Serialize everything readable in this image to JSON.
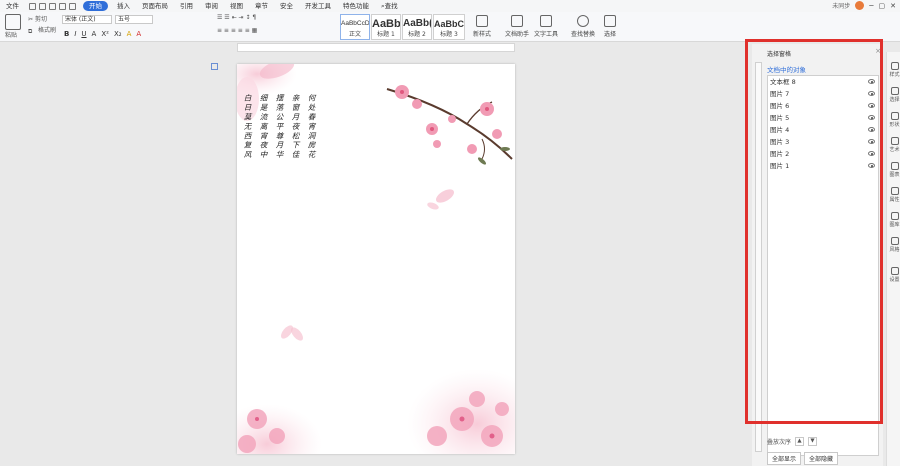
{
  "menu": {
    "file": "文件",
    "items": [
      "开始",
      "插入",
      "页面布局",
      "引用",
      "审阅",
      "视图",
      "章节",
      "安全",
      "开发工具",
      "特色功能"
    ],
    "active": "开始",
    "search": "查找",
    "sync": "未同步"
  },
  "ribbon": {
    "cut": "剪切",
    "paste": "粘贴",
    "format_painter": "格式刷",
    "font_name": "宋体 (正文)",
    "font_size": "五号",
    "format_buttons": [
      "B",
      "I",
      "U",
      "A",
      "X²",
      "X₂",
      "A",
      "A"
    ],
    "styles": [
      {
        "sample": "AaBbCcDd",
        "label": "正文"
      },
      {
        "sample": "AaBb",
        "label": "标题 1"
      },
      {
        "sample": "AaBb(",
        "label": "标题 2"
      },
      {
        "sample": "AaBbC",
        "label": "标题 3"
      }
    ],
    "new_style": "新样式",
    "doc_assistant": "文档助手",
    "text_tools": "文字工具",
    "find_replace": "查找替换",
    "select": "选择"
  },
  "document": {
    "poem_columns": [
      "何处春宵洞房花",
      "亲窗月夜松下佳",
      "摆落公平尊月华",
      "细是流离宵夜中",
      "白日莫无西复风",
      "漫游宫高作开",
      "前花春花月",
      "情明宫西"
    ]
  },
  "selection_pane": {
    "title": "选择窗格",
    "subtitle": "文档中的对象",
    "objects": [
      "文本框 8",
      "图片 7",
      "图片 6",
      "图片 5",
      "图片 4",
      "图片 3",
      "图片 2",
      "图片 1"
    ],
    "order_label": "叠放次序",
    "show_all": "全部显示",
    "hide_all": "全部隐藏"
  },
  "side_panel": [
    "样式",
    "选择",
    "形状",
    "艺术",
    "图表",
    "属性",
    "图库",
    "风格",
    "设置"
  ]
}
